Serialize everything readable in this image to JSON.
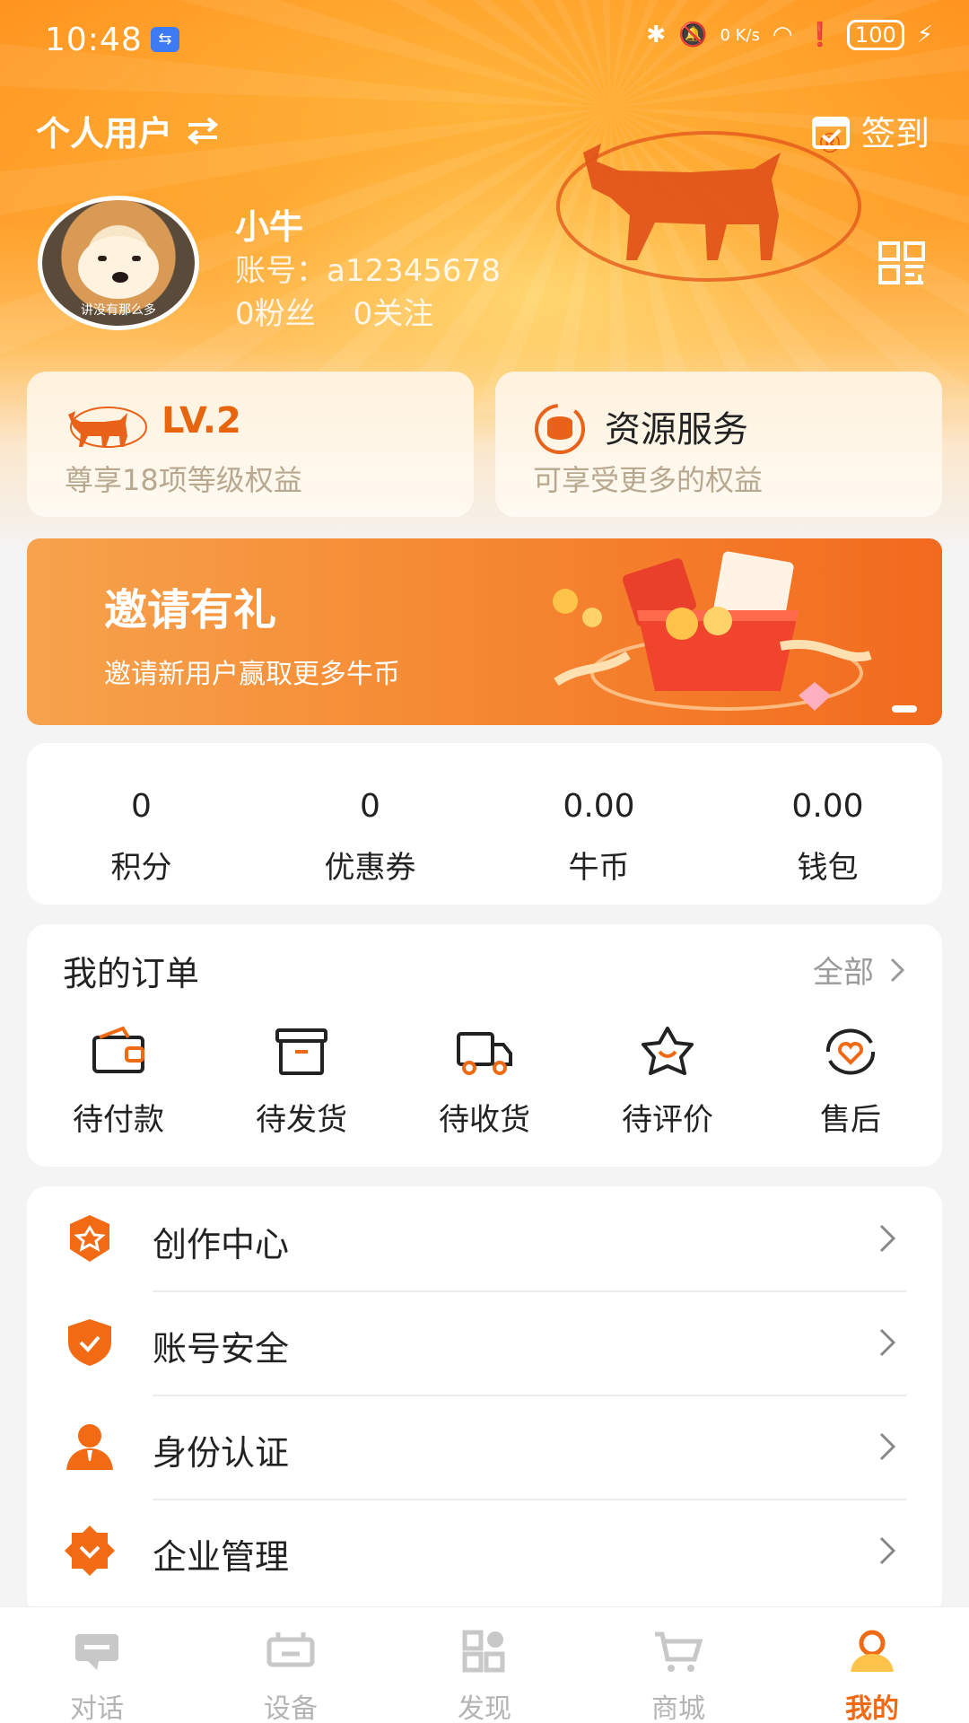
{
  "status_bar": {
    "time": "10:48",
    "network_speed": "0 K/s",
    "battery": "100"
  },
  "header": {
    "account_type": "个人用户",
    "switch_icon": "swap-arrows-icon",
    "checkin_label": "签到"
  },
  "profile": {
    "nickname": "小牛",
    "account_label": "账号：",
    "account_id": "a12345678",
    "followers": "0粉丝",
    "following": "0关注",
    "avatar_caption": "讲没有那么多"
  },
  "cards": {
    "level": {
      "title": "LV.2",
      "subtitle": "尊享18项等级权益"
    },
    "resource": {
      "title": "资源服务",
      "subtitle": "可享受更多的权益"
    }
  },
  "banner": {
    "title": "邀请有礼",
    "subtitle": "邀请新用户赢取更多牛币"
  },
  "stats": [
    {
      "value": "0",
      "label": "积分"
    },
    {
      "value": "0",
      "label": "优惠券"
    },
    {
      "value": "0.00",
      "label": "牛币"
    },
    {
      "value": "0.00",
      "label": "钱包"
    }
  ],
  "orders": {
    "title": "我的订单",
    "all_label": "全部",
    "items": [
      {
        "label": "待付款",
        "icon": "wallet-icon"
      },
      {
        "label": "待发货",
        "icon": "box-icon"
      },
      {
        "label": "待收货",
        "icon": "truck-icon"
      },
      {
        "label": "待评价",
        "icon": "star-icon"
      },
      {
        "label": "售后",
        "icon": "aftersale-icon"
      }
    ]
  },
  "menu": [
    {
      "label": "创作中心",
      "icon": "create-icon"
    },
    {
      "label": "账号安全",
      "icon": "shield-icon"
    },
    {
      "label": "身份认证",
      "icon": "person-icon"
    },
    {
      "label": "企业管理",
      "icon": "enterprise-icon"
    }
  ],
  "tabbar": [
    {
      "label": "对话",
      "icon": "chat-icon"
    },
    {
      "label": "设备",
      "icon": "device-icon"
    },
    {
      "label": "发现",
      "icon": "discover-icon"
    },
    {
      "label": "商城",
      "icon": "cart-icon"
    },
    {
      "label": "我的",
      "icon": "profile-icon",
      "active": true
    }
  ],
  "colors": {
    "accent": "#ef6a14",
    "header": "#ff9a26",
    "muted": "#b4b4b4"
  }
}
